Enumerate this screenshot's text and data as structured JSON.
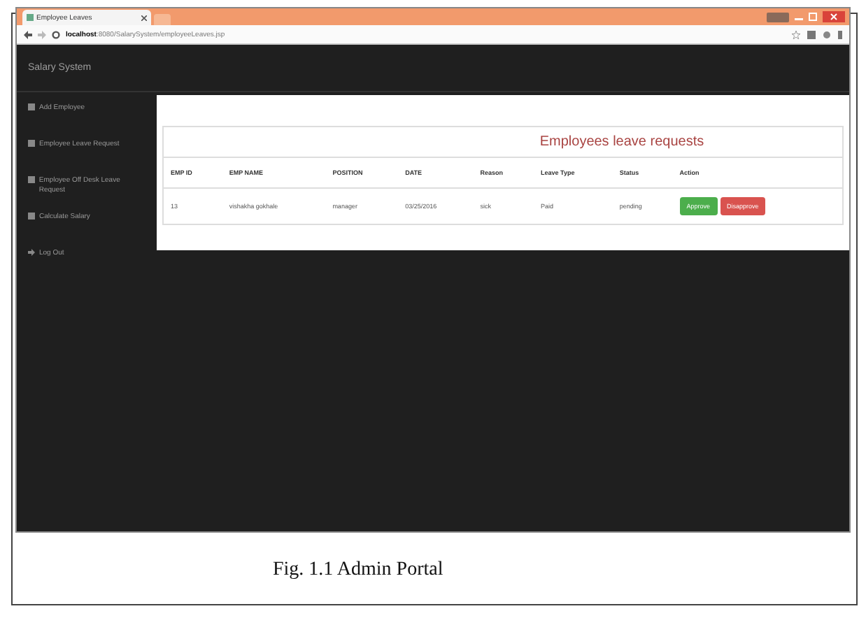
{
  "browser": {
    "tab_title": "Employee Leaves",
    "url_host": "localhost",
    "url_path": ":8080/SalarySystem/employeeLeaves.jsp"
  },
  "header": {
    "brand": "Salary System"
  },
  "sidebar": {
    "items": [
      {
        "label": "Add Employee",
        "kind": "square"
      },
      {
        "label": "Employee Leave Request",
        "kind": "square"
      },
      {
        "label": "Employee Off Desk Leave Request",
        "kind": "square"
      },
      {
        "label": "Calculate Salary",
        "kind": "square"
      },
      {
        "label": "Log Out",
        "kind": "arrow"
      }
    ]
  },
  "panel": {
    "title": "Employees leave requests",
    "table": {
      "columns": [
        "EMP ID",
        "EMP NAME",
        "POSITION",
        "DATE",
        "Reason",
        "Leave Type",
        "Status",
        "Action"
      ],
      "rows": [
        {
          "cells": [
            "13",
            "vishakha gokhale",
            "manager",
            "03/25/2016",
            "sick",
            "Paid",
            "pending"
          ],
          "actions": [
            {
              "label": "Approve",
              "kind": "approve"
            },
            {
              "label": "Disapprove",
              "kind": "disapprove"
            }
          ]
        }
      ]
    }
  },
  "caption": "Fig. 1.1 Admin Portal"
}
